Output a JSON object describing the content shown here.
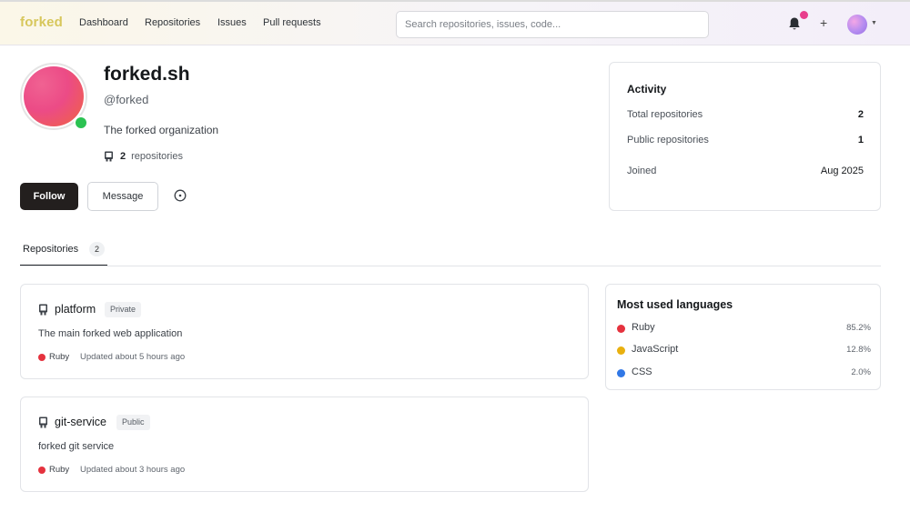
{
  "nav": {
    "logo": "forked",
    "links": [
      "Dashboard",
      "Repositories",
      "Issues",
      "Pull requests"
    ],
    "search_placeholder": "Search repositories, issues, code...",
    "notification_color": "#e83e8c"
  },
  "profile": {
    "name": "forked.sh",
    "handle": "@forked",
    "description": "The forked organization",
    "repo_count": "2",
    "repo_label": "repositories",
    "status_color": "#2bc252",
    "follow_label": "Follow",
    "message_label": "Message"
  },
  "activity": {
    "title": "Activity",
    "rows": [
      {
        "label": "Total repositories",
        "value": "2"
      },
      {
        "label": "Public repositories",
        "value": "1"
      },
      {
        "label": "Joined",
        "value": "Aug 2025"
      }
    ]
  },
  "tabs": [
    {
      "label": "Repositories",
      "count": "2"
    }
  ],
  "repositories": [
    {
      "name": "platform",
      "visibility": "Private",
      "description": "The main forked web application",
      "language": "Ruby",
      "language_color": "#e5323e",
      "updated": "Updated about 5 hours ago"
    },
    {
      "name": "git-service",
      "visibility": "Public",
      "description": "forked git service",
      "language": "Ruby",
      "language_color": "#e5323e",
      "updated": "Updated about 3 hours ago"
    }
  ],
  "languages": {
    "title": "Most used languages",
    "items": [
      {
        "name": "Ruby",
        "percent": "85.2%",
        "color": "#e5323e"
      },
      {
        "name": "JavaScript",
        "percent": "12.8%",
        "color": "#e9b00f"
      },
      {
        "name": "CSS",
        "percent": "2.0%",
        "color": "#3178e6"
      }
    ]
  }
}
